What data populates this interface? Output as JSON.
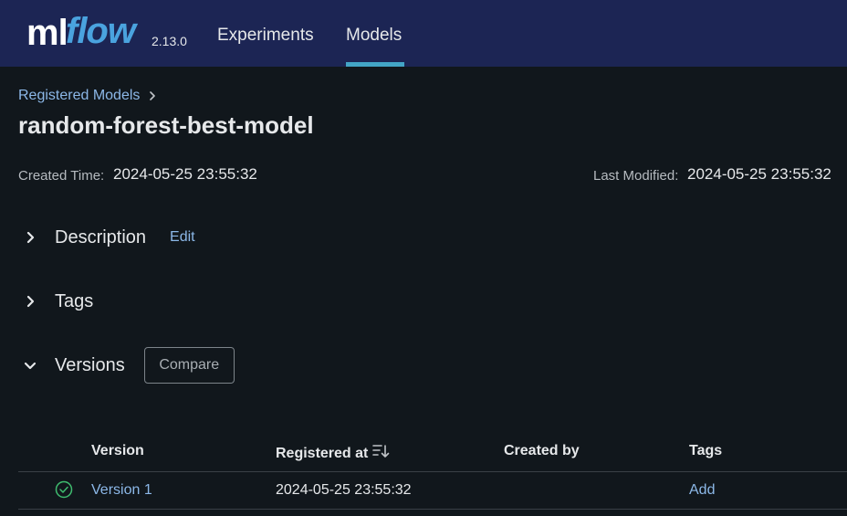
{
  "header": {
    "logo_ml": "ml",
    "logo_flow": "flow",
    "version": "2.13.0",
    "nav": [
      {
        "label": "Experiments",
        "active": false
      },
      {
        "label": "Models",
        "active": true
      }
    ],
    "accent_color": "#43a5c6",
    "background_color": "#1c2554"
  },
  "breadcrumb": {
    "items": [
      "Registered Models"
    ]
  },
  "page": {
    "title": "random-forest-best-model"
  },
  "metadata": {
    "created_label": "Created Time:",
    "created_value": "2024-05-25 23:55:32",
    "modified_label": "Last Modified:",
    "modified_value": "2024-05-25 23:55:32"
  },
  "sections": {
    "description": {
      "title": "Description",
      "edit_label": "Edit",
      "expanded": false
    },
    "tags": {
      "title": "Tags",
      "expanded": false
    },
    "versions": {
      "title": "Versions",
      "compare_label": "Compare",
      "expanded": true
    }
  },
  "versions_table": {
    "columns": [
      "Version",
      "Registered at",
      "Created by",
      "Tags"
    ],
    "rows": [
      {
        "status": "ready",
        "version": "Version 1",
        "registered_at": "2024-05-25 23:55:32",
        "created_by": "",
        "tags_action": "Add"
      }
    ]
  },
  "icons": {
    "breadcrumb_separator": "chevron-right-icon",
    "collapsed": "chevron-right-icon",
    "expanded": "chevron-down-icon",
    "sort": "sort-descending-icon",
    "status": "check-circle-icon"
  },
  "colors": {
    "page_background": "#11171c",
    "link": "#8cb8e8",
    "status_ok": "#3fbc6f"
  }
}
